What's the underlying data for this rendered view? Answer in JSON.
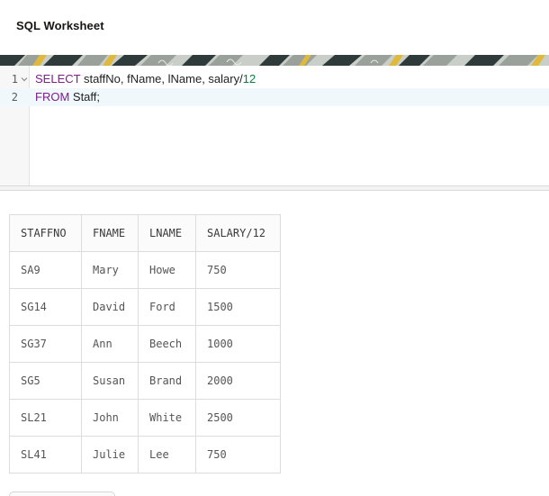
{
  "header": {
    "title": "SQL Worksheet"
  },
  "editor": {
    "lines": [
      {
        "number": "1",
        "tokens": [
          {
            "text": "SELECT",
            "kind": "keyword"
          },
          {
            "text": " staffNo, fName, lName, salary/",
            "kind": "plain"
          },
          {
            "text": "12",
            "kind": "number"
          }
        ]
      },
      {
        "number": "2",
        "tokens": [
          {
            "text": "FROM",
            "kind": "keyword"
          },
          {
            "text": " Staff;",
            "kind": "plain"
          }
        ]
      }
    ],
    "fold_icon": "chevron-down-icon"
  },
  "results": {
    "columns": [
      "STAFFNO",
      "FNAME",
      "LNAME",
      "SALARY/12"
    ],
    "rows": [
      [
        "SA9",
        "Mary",
        "Howe",
        "750"
      ],
      [
        "SG14",
        "David",
        "Ford",
        "1500"
      ],
      [
        "SG37",
        "Ann",
        "Beech",
        "1000"
      ],
      [
        "SG5",
        "Susan",
        "Brand",
        "2000"
      ],
      [
        "SL21",
        "John",
        "White",
        "2500"
      ],
      [
        "SL41",
        "Julie",
        "Lee",
        "750"
      ]
    ]
  },
  "colors": {
    "keyword": "#7c1d8a",
    "number": "#0a7b45",
    "active_line": "#f0f8fc",
    "banner_dark": "#2f3b3a",
    "banner_gray": "#9aa19a",
    "banner_light": "#c9cec8",
    "banner_yellow": "#e0b93c"
  }
}
